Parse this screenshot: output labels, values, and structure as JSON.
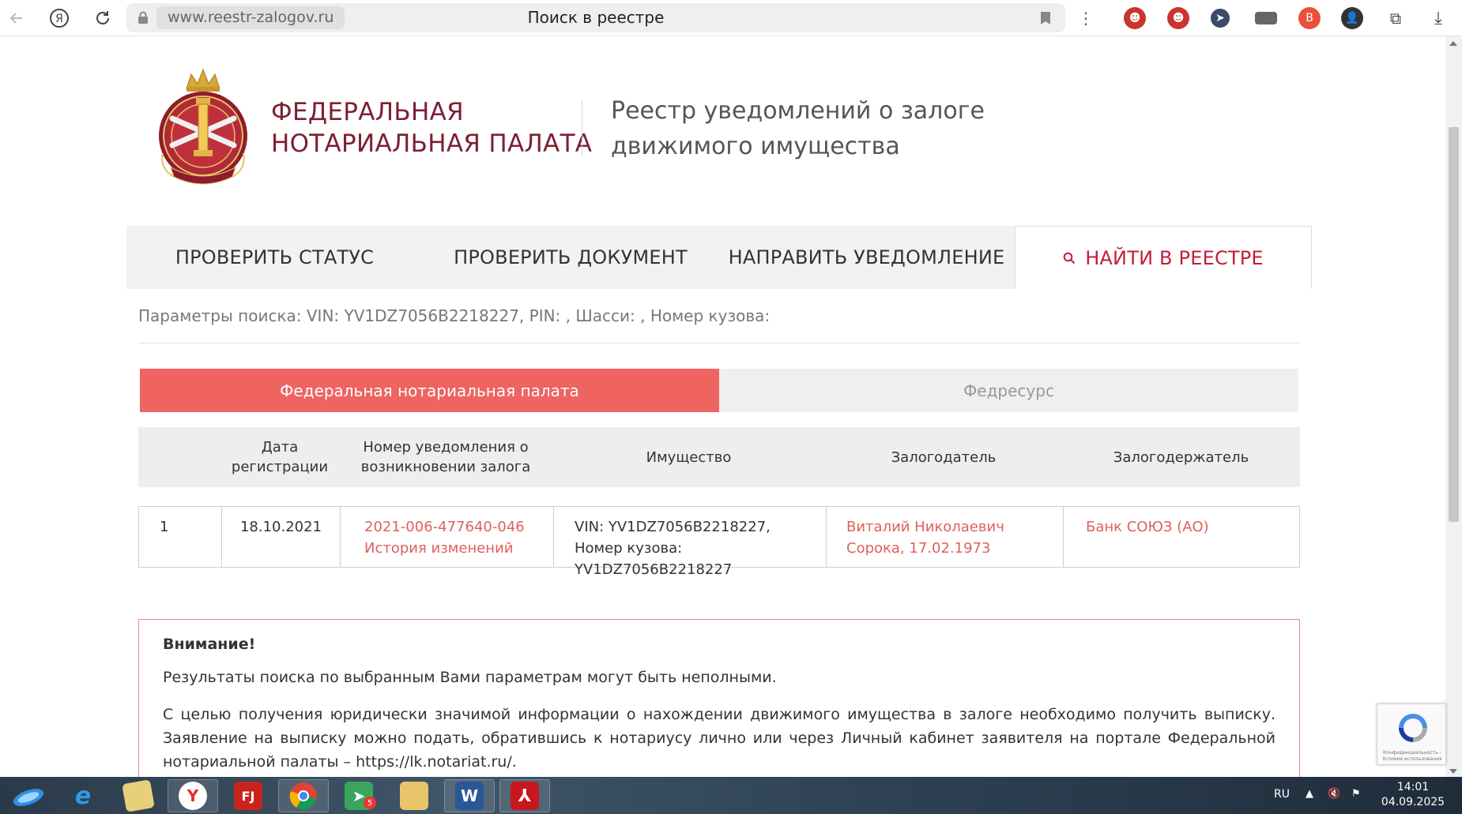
{
  "browser": {
    "domain": "www.reestr-zalogov.ru",
    "page_title": "Поиск в реестре"
  },
  "header": {
    "org_line1": "ФЕДЕРАЛЬНАЯ",
    "org_line2": "НОТАРИАЛЬНАЯ ПАЛАТА",
    "registry_line1": "Реестр уведомлений о залоге",
    "registry_line2": "движимого имущества"
  },
  "nav": {
    "items": [
      {
        "label": "ПРОВЕРИТЬ СТАТУС"
      },
      {
        "label": "ПРОВЕРИТЬ ДОКУМЕНТ"
      },
      {
        "label": "НАПРАВИТЬ УВЕДОМЛЕНИЕ"
      },
      {
        "label": "НАЙТИ В РЕЕСТРЕ",
        "active": true
      }
    ]
  },
  "search_params": "Параметры поиска: VIN: YV1DZ7056B2218227, PIN: , Шасси: , Номер кузова:",
  "source_tabs": [
    {
      "label": "Федеральная нотариальная палата",
      "active": true
    },
    {
      "label": "Федресурс",
      "active": false
    }
  ],
  "table": {
    "columns": [
      "",
      "Дата регистрации",
      "Номер уведомления о возникновении залога",
      "Имущество",
      "Залогодатель",
      "Залогодержатель"
    ],
    "rows": [
      {
        "num": "1",
        "date": "18.10.2021",
        "notice_number": "2021-006-477640-046",
        "history_link": "История изменений",
        "property": "VIN: YV1DZ7056B2218227, Номер кузова: YV1DZ7056B2218227",
        "pledgor": "Виталий Николаевич Сорока, 17.02.1973",
        "pledgee": "Банк СОЮЗ (АО)"
      }
    ]
  },
  "notice": {
    "title": "Внимание!",
    "p1": "Результаты поиска по выбранным Вами параметрам могут быть неполными.",
    "p2": "С целью получения юридически значимой информации о нахождении движимого имущества в залоге необходимо получить выписку. Заявление на выписку можно подать, обратившись к нотариусу лично или через Личный кабинет заявителя на портале Федеральной нотариальной палаты – https://lk.notariat.ru/."
  },
  "recaptcha": {
    "text": "Конфиденциальность - Условия использования"
  },
  "taskbar": {
    "lang": "RU",
    "time": "14:01",
    "date": "04.09.2025",
    "badge_count": "5"
  },
  "colors": {
    "brand": "#7e1f32",
    "accent_red": "#c41e3a",
    "tab_active": "#ef6361",
    "link": "#e0605c"
  }
}
